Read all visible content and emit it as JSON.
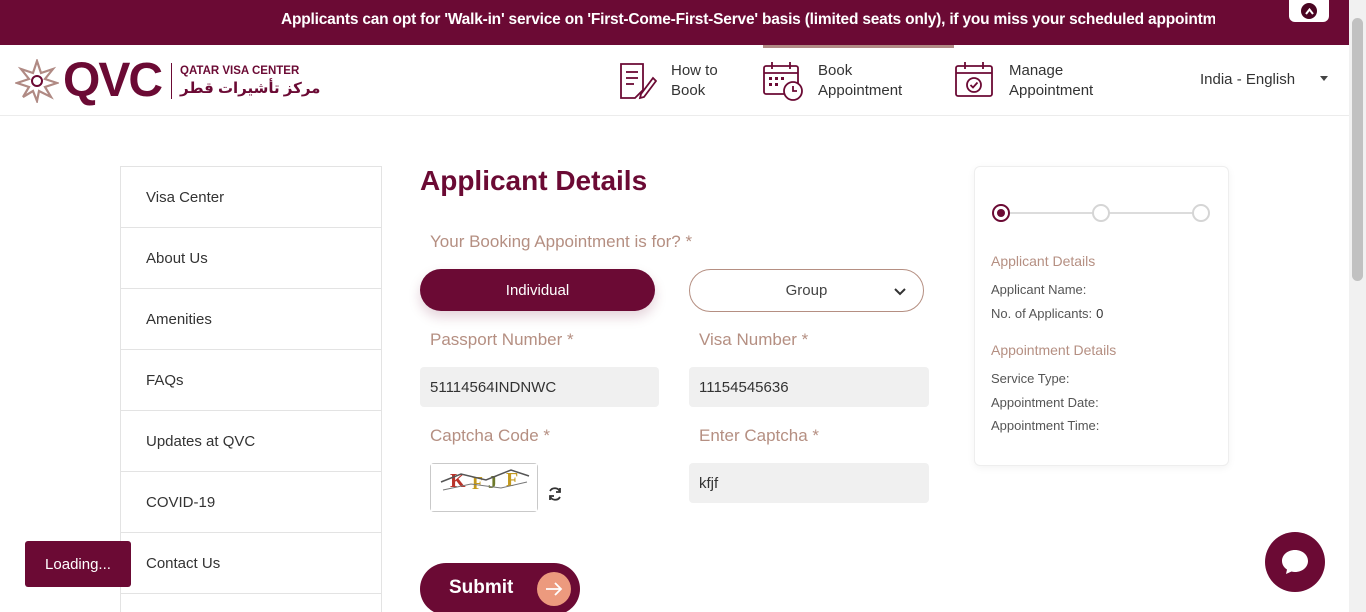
{
  "banner": {
    "text": "Applicants can opt for 'Walk-in' service on 'First-Come-First-Serve' basis (limited seats only), if you miss your scheduled appointment",
    "scroll_top_icon": "chevron-up-icon"
  },
  "header": {
    "logo": {
      "wordmark": "QVC",
      "name_en": "QATAR VISA CENTER",
      "name_ar": "مركز تأشيرات قطر"
    },
    "nav": [
      {
        "label_line1": "How to",
        "label_line2": "Book",
        "icon": "document-edit-icon"
      },
      {
        "label_line1": "Book",
        "label_line2": "Appointment",
        "icon": "calendar-clock-icon",
        "active": true
      },
      {
        "label_line1": "Manage",
        "label_line2": "Appointment",
        "icon": "calendar-check-icon"
      }
    ],
    "language": "India - English"
  },
  "sidebar": {
    "items": [
      {
        "label": "Visa Center"
      },
      {
        "label": "About Us"
      },
      {
        "label": "Amenities"
      },
      {
        "label": "FAQs"
      },
      {
        "label": "Updates at QVC"
      },
      {
        "label": "COVID-19"
      },
      {
        "label": "Contact Us"
      }
    ]
  },
  "form": {
    "title": "Applicant Details",
    "booking_for_label": "Your Booking Appointment is for? *",
    "individual_label": "Individual",
    "group_label": "Group",
    "passport_label": "Passport Number *",
    "passport_value": "51114564INDNWC",
    "visa_label": "Visa Number *",
    "visa_value": "11154545636",
    "captcha_label": "Captcha Code *",
    "captcha_chars": [
      "K",
      "F",
      "J",
      "F"
    ],
    "enter_captcha_label": "Enter Captcha *",
    "enter_captcha_value": "kfjf",
    "submit_label": "Submit"
  },
  "summary": {
    "steps": 3,
    "current_step": 1,
    "applicant_heading": "Applicant Details",
    "applicant_name_label": "Applicant Name:",
    "applicant_name_value": "",
    "num_applicants_label": "No. of Applicants:",
    "num_applicants_value": "0",
    "appointment_heading": "Appointment Details",
    "service_type_label": "Service Type:",
    "appointment_date_label": "Appointment Date:",
    "appointment_time_label": "Appointment Time:"
  },
  "loading_text": "Loading...",
  "colors": {
    "brand": "#6b0a34",
    "label": "#b58f82",
    "accent": "#ec9a7e"
  }
}
